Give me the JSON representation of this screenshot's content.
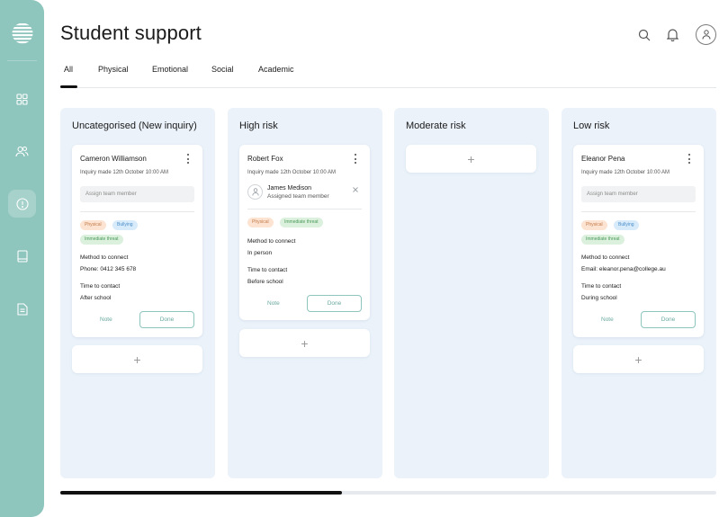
{
  "app": {
    "title": "Student support"
  },
  "tabs": [
    {
      "label": "All",
      "active": true
    },
    {
      "label": "Physical"
    },
    {
      "label": "Emotional"
    },
    {
      "label": "Social"
    },
    {
      "label": "Academic"
    }
  ],
  "sidebar": {
    "items": [
      {
        "icon": "grid-icon"
      },
      {
        "icon": "users-icon"
      },
      {
        "icon": "alert-circle-icon",
        "active": true
      },
      {
        "icon": "book-icon"
      },
      {
        "icon": "document-icon"
      }
    ]
  },
  "colors": {
    "sidebar": "#8ec5bd",
    "column_bg": "#ebf2fa",
    "accent": "#6aa99f",
    "tag_physical": "#fde4d2",
    "tag_bullying": "#d8ebfb",
    "tag_threat": "#dcf0de"
  },
  "columns": [
    {
      "title": "Uncategorised (New inquiry)",
      "card": {
        "name": "Cameron Williamson",
        "date": "Inquiry made 12th October 10:00 AM",
        "assign_placeholder": "Assign team member",
        "tags": [
          "Physical",
          "Bullying",
          "Immediate threat"
        ],
        "method_label": "Method to connect",
        "method_value": "Phone: 0412 345 678",
        "time_label": "Time to contact",
        "time_value": "After school",
        "note_label": "Note",
        "done_label": "Done"
      },
      "add_label": "+"
    },
    {
      "title": "High risk",
      "card": {
        "name": "Robert Fox",
        "date": "Inquiry made 12th October 10:00 AM",
        "member_name": "James Medison",
        "member_role": "Assigned team member",
        "tags": [
          "Physical",
          "Immediate threat"
        ],
        "method_label": "Method to connect",
        "method_value": "In person",
        "time_label": "Time to contact",
        "time_value": "Before school",
        "note_label": "Note",
        "done_label": "Done"
      },
      "add_label": "+"
    },
    {
      "title": "Moderate risk",
      "add_label": "+"
    },
    {
      "title": "Low risk",
      "card": {
        "name": "Eleanor Pena",
        "date": "Inquiry made 12th October 10:00 AM",
        "assign_placeholder": "Assign team member",
        "tags": [
          "Physical",
          "Bullying",
          "Immediate threat"
        ],
        "method_label": "Method to connect",
        "method_value": "Email: eleanor.pena@college.au",
        "time_label": "Time to contact",
        "time_value": "During school",
        "note_label": "Note",
        "done_label": "Done"
      },
      "add_label": "+"
    }
  ],
  "scroll": {
    "progress": 0.43
  }
}
